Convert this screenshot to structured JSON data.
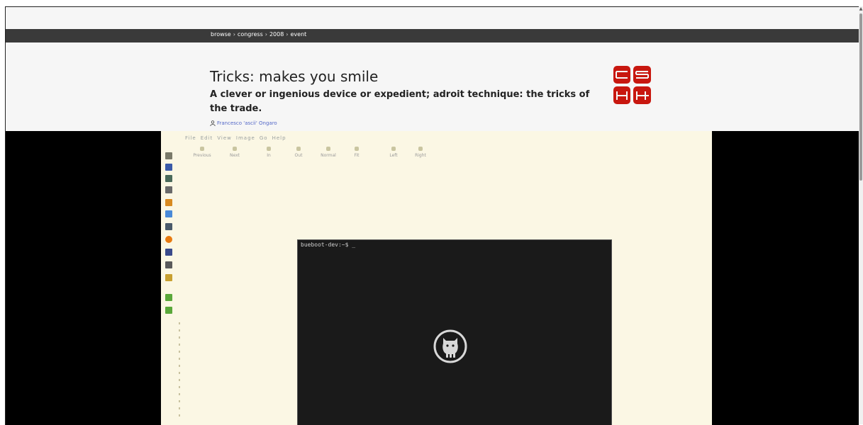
{
  "breadcrumb": {
    "items": [
      "browse",
      "congress",
      "2008",
      "event"
    ],
    "separator": "›"
  },
  "talk": {
    "title": "Tricks: makes you smile",
    "subtitle": "A clever or ingenious device or expedient; adroit technique: the tricks of the trade.",
    "author": "Francesco 'ascii' Ongaro"
  },
  "logo": {
    "icon": "congress-logo",
    "color": "#c8170f"
  },
  "video": {
    "menu": [
      "File",
      "Edit",
      "View",
      "Image",
      "Go",
      "Help"
    ],
    "toolbar": [
      "Previous",
      "Next",
      "In",
      "Out",
      "Normal",
      "Fit",
      "Left",
      "Right"
    ],
    "terminal_prompt": "bueboot-dev:~$ _",
    "play_icon": "play-cat-icon"
  }
}
